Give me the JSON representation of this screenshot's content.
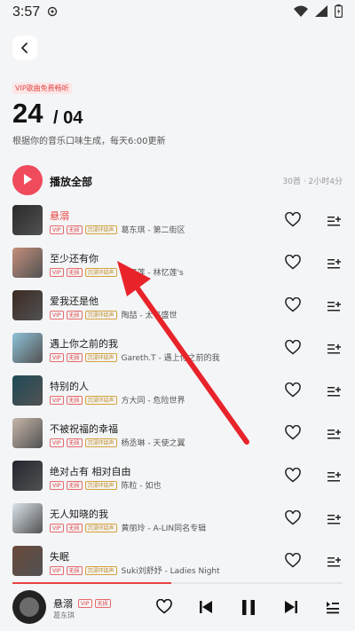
{
  "status_bar": {
    "time": "3:57"
  },
  "header": {
    "vip_tag": "VIP歌曲免费畅听",
    "date_day": "24",
    "date_month": "/ 04",
    "subtitle": "根据你的音乐口味生成，每天6:00更新"
  },
  "play_all": {
    "label": "播放全部",
    "meta": "30首 · 2小时4分"
  },
  "songs": [
    {
      "title": "悬溺",
      "badges": [
        "VIP",
        "无损",
        "沉浸环绕声"
      ],
      "artist": "葛东琪 - 第二街区",
      "playing": true,
      "cover": "#2a2a2a"
    },
    {
      "title": "至少还有你",
      "badges": [
        "VIP",
        "无损",
        "沉浸环绕声"
      ],
      "artist": "林忆莲 - 林忆莲's",
      "playing": false,
      "cover": "#c48f7a"
    },
    {
      "title": "爱我还是他",
      "badges": [
        "VIP",
        "无损",
        "沉浸环绕声"
      ],
      "artist": "陶喆 - 太平盛世",
      "playing": false,
      "cover": "#3b2a22"
    },
    {
      "title": "遇上你之前的我",
      "badges": [
        "VIP",
        "无损",
        "沉浸环绕声"
      ],
      "artist": "Gareth.T - 遇上你之前的我",
      "playing": false,
      "cover": "#8fc3d8"
    },
    {
      "title": "特别的人",
      "badges": [
        "VIP",
        "无损",
        "沉浸环绕声"
      ],
      "artist": "方大同 - 危险世界",
      "playing": false,
      "cover": "#1f4b57"
    },
    {
      "title": "不被祝福的幸福",
      "badges": [
        "VIP",
        "无损",
        "沉浸环绕声"
      ],
      "artist": "杨丞琳 - 天使之翼",
      "playing": false,
      "cover": "#c7b6a8"
    },
    {
      "title": "绝对占有 相对自由",
      "badges": [
        "VIP",
        "无损",
        "沉浸环绕声"
      ],
      "artist": "陈粒 - 如也",
      "playing": false,
      "cover": "#23262e"
    },
    {
      "title": "无人知晓的我",
      "badges": [
        "VIP",
        "无损",
        "沉浸环绕声"
      ],
      "artist": "黄丽玲 - A-LIN同名专辑",
      "playing": false,
      "cover": "#dbe4ea"
    },
    {
      "title": "失眠",
      "badges": [
        "VIP",
        "无损",
        "沉浸环绕声"
      ],
      "artist": "Suki刘舒妤 - Ladies Night",
      "playing": false,
      "cover": "#6a4a3a"
    }
  ],
  "player": {
    "title": "悬溺",
    "badges": [
      "VIP",
      "无损"
    ],
    "artist": "葛东琪",
    "progress": 0.48
  },
  "colors": {
    "accent": "#e8423e",
    "background": "#f4f5f7",
    "arrow": "#e8232a"
  }
}
